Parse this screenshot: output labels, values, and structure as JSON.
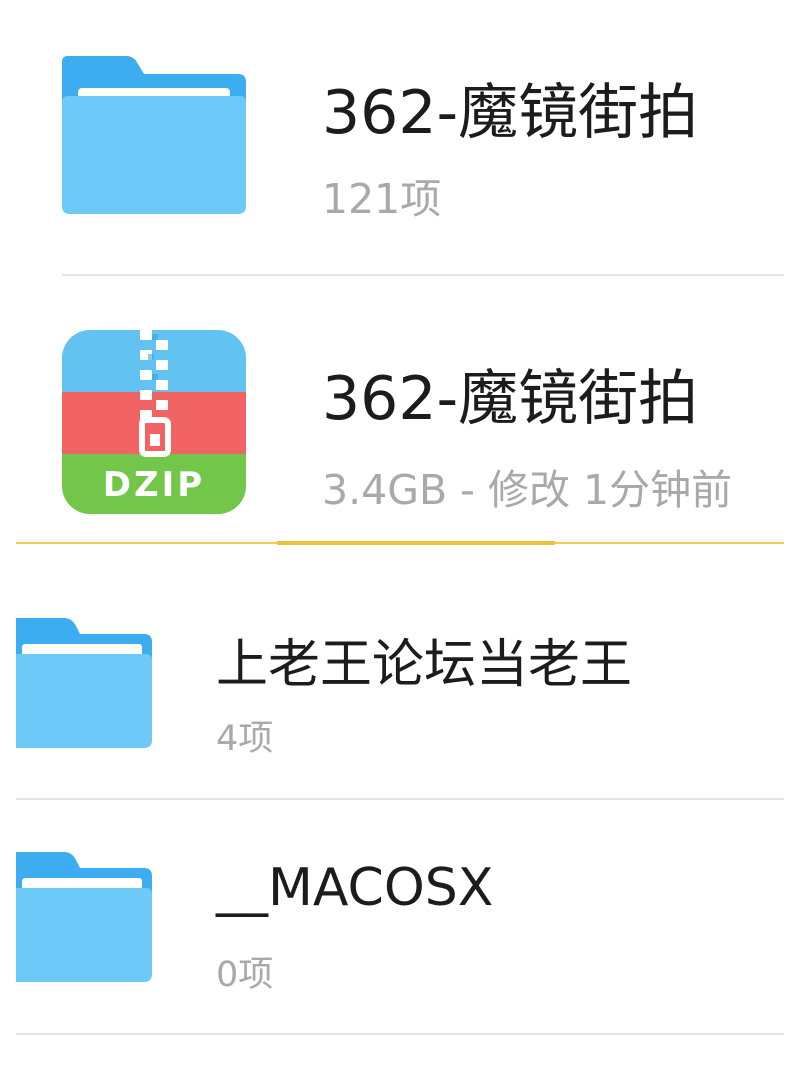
{
  "files": [
    {
      "name": "362-魔镜街拍",
      "meta": "121项",
      "icon": "folder-icon"
    },
    {
      "name": "362-魔镜街拍",
      "meta": "3.4GB - 修改 1分钟前",
      "icon": "zip-archive-icon",
      "badge": "DZIP"
    },
    {
      "name": "上老王论坛当老王",
      "meta": "4项",
      "icon": "folder-icon"
    },
    {
      "name": "__MACOSX",
      "meta": "0项",
      "icon": "folder-icon"
    }
  ],
  "colors": {
    "folder_back": "#3badf0",
    "folder_front": "#6dc9f8",
    "zip_blue": "#62c3f2",
    "zip_red": "#f26464",
    "zip_green": "#72c64a",
    "progress_accent": "#f0c13e",
    "divider": "#e4e4e6",
    "subtext": "#a9a9ad"
  }
}
